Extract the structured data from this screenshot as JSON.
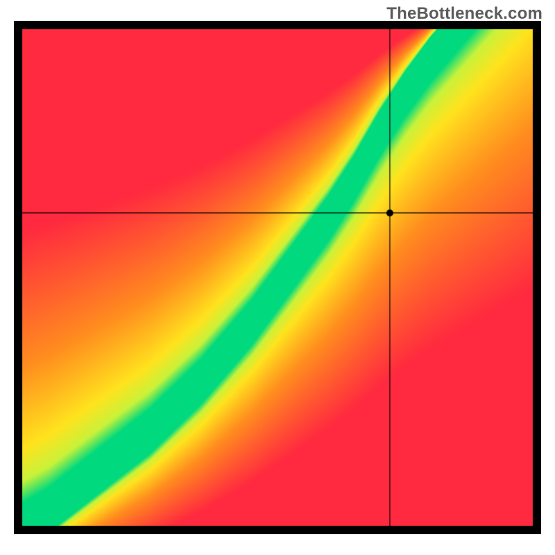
{
  "watermark": "TheBottleneck.com",
  "chart_data": {
    "type": "heatmap",
    "title": "",
    "xlabel": "",
    "ylabel": "",
    "xlim": [
      0,
      1
    ],
    "ylim": [
      0,
      1
    ],
    "marker": {
      "x": 0.72,
      "y": 0.63
    },
    "crosshair": true,
    "grid": false,
    "colors": {
      "red": "#ff2a3f",
      "orange": "#ff8e1e",
      "yellow": "#ffe31e",
      "yellowgreen": "#c9f23a",
      "green": "#00d97e"
    },
    "_note": "Heatmap depicts a narrow optimal (green) band along a roughly diagonal ridge, flanked by yellow→orange→red gradient as you move away from the ridge. Ridge control points below are (x, y_ridge_fraction) from bottom-left origin.",
    "ridge": [
      {
        "x": 0.0,
        "y": 0.0
      },
      {
        "x": 0.05,
        "y": 0.03
      },
      {
        "x": 0.1,
        "y": 0.07
      },
      {
        "x": 0.15,
        "y": 0.11
      },
      {
        "x": 0.2,
        "y": 0.15
      },
      {
        "x": 0.25,
        "y": 0.19
      },
      {
        "x": 0.3,
        "y": 0.24
      },
      {
        "x": 0.35,
        "y": 0.29
      },
      {
        "x": 0.4,
        "y": 0.35
      },
      {
        "x": 0.45,
        "y": 0.41
      },
      {
        "x": 0.5,
        "y": 0.48
      },
      {
        "x": 0.55,
        "y": 0.55
      },
      {
        "x": 0.6,
        "y": 0.62
      },
      {
        "x": 0.65,
        "y": 0.7
      },
      {
        "x": 0.7,
        "y": 0.79
      },
      {
        "x": 0.75,
        "y": 0.87
      },
      {
        "x": 0.8,
        "y": 0.94
      },
      {
        "x": 0.85,
        "y": 1.0
      }
    ],
    "band_half_width_y": 0.045,
    "falloff_scale": 0.55
  }
}
